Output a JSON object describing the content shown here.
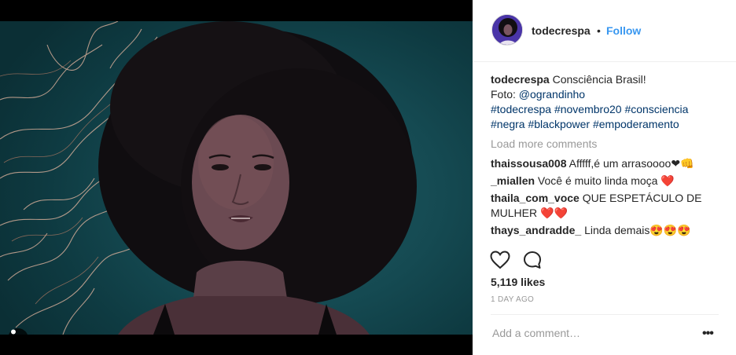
{
  "post": {
    "author": "todecrespa",
    "separator": "•",
    "follow_label": "Follow",
    "caption_author": "todecrespa",
    "caption_text": "Consciência Brasil!",
    "caption_foto_prefix": "Foto: ",
    "caption_foto_handle": "@ograndinho",
    "hashtags_line1": "#todecrespa #novembro20 #consciencia",
    "hashtags_line2": "#negra #blackpower #empoderamento",
    "load_more": "Load more comments",
    "comments": [
      {
        "user": "thaissousa008",
        "text": "Afffff,é um arrasoooo❤👊"
      },
      {
        "user": "_miallen",
        "text": "Você é muito linda moça ❤️"
      },
      {
        "user": "thaila_com_voce",
        "text": "QUE ESPETÁCULO DE MULHER ❤️❤️"
      },
      {
        "user": "thays_andradde_",
        "text": "Linda demais😍😍😍"
      }
    ],
    "likes": "5,119 likes",
    "date": "1 DAY AGO",
    "add_comment_placeholder": "Add a comment…",
    "more_options": "•••"
  },
  "icons": {
    "like": "heart-icon",
    "comment": "comment-bubble-icon",
    "user_tag": "person-tag-icon"
  }
}
